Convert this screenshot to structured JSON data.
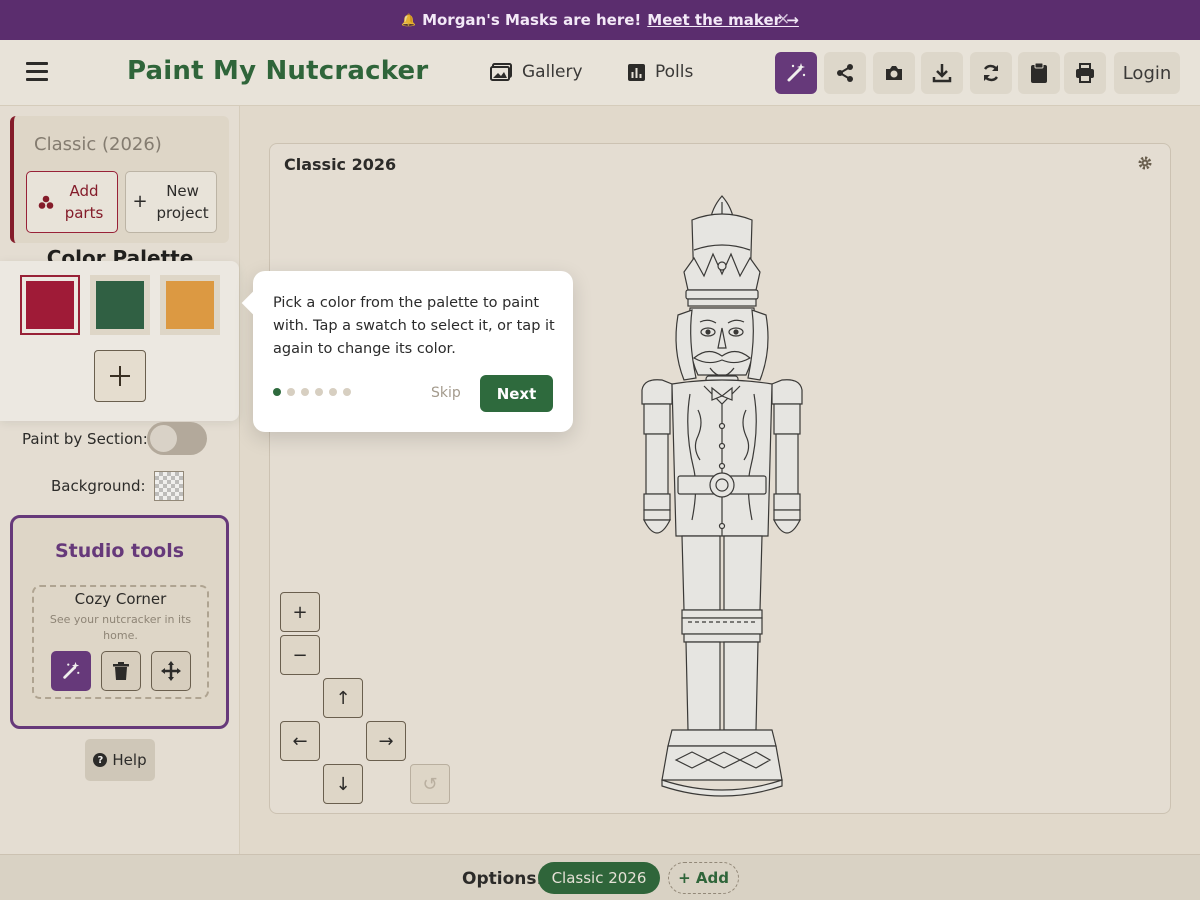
{
  "announcement": {
    "icon": "bell-icon",
    "text": "Morgan's Masks are here!",
    "link": "Meet the maker →",
    "close": "×"
  },
  "header": {
    "brand": "Paint My Nutcracker",
    "nav": {
      "gallery": "Gallery",
      "polls": "Polls"
    },
    "tools": [
      "magic-wand-icon",
      "share-icon",
      "camera-icon",
      "download-icon",
      "refresh-icon",
      "clipboard-icon",
      "print-icon"
    ],
    "login": "Login"
  },
  "sidebar": {
    "project_title": "Classic (2026)",
    "add_parts": "Add parts",
    "new_project": "New project",
    "palette_title": "Color Palette",
    "swatches": [
      {
        "color": "#a8193a",
        "selected": true
      },
      {
        "color": "#2f6447",
        "selected": false
      },
      {
        "color": "#eaa246",
        "selected": false
      }
    ],
    "paint_by_section_label": "Paint by Section:",
    "paint_by_section_on": false,
    "background_label": "Background:",
    "studio": {
      "title": "Studio tools",
      "item_title": "Cozy Corner",
      "item_desc": "See your nutcracker in its home."
    },
    "help": "Help"
  },
  "canvas": {
    "title": "Classic 2026",
    "zoom_in": "+",
    "zoom_out": "−",
    "up": "↑",
    "left": "←",
    "right": "→",
    "down": "↓",
    "undo": "↺"
  },
  "tooltip": {
    "text": "Pick a color from the palette to paint with. Tap a swatch to select it, or tap it again to change its color.",
    "steps_total": 6,
    "step_current": 1,
    "skip": "Skip",
    "next": "Next"
  },
  "footer": {
    "options_label": "Options:",
    "selected_option": "Classic 2026",
    "add": "+ Add"
  },
  "colors": {
    "brand_green": "#2e6a3d",
    "accent_purple": "#6a3a83",
    "announce_bg": "#5b2d6e",
    "crimson": "#a8193a"
  }
}
